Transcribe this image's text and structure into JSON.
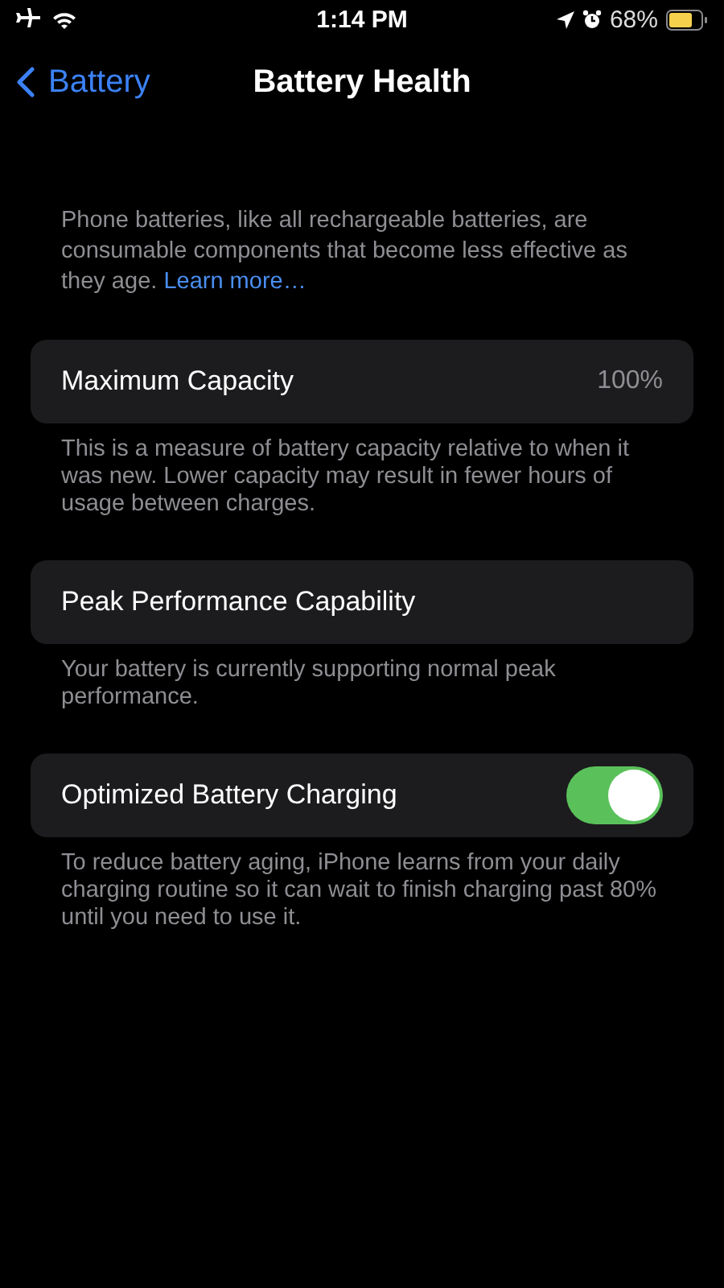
{
  "status_bar": {
    "time": "1:14 PM",
    "battery": "68%"
  },
  "nav": {
    "back": "Battery",
    "title": "Battery Health"
  },
  "intro": {
    "text": "Phone batteries, like all rechargeable batteries, are consumable components that become less effective as they age.",
    "link": "Learn more…"
  },
  "sections": [
    {
      "kind": "value",
      "label": "Maximum Capacity",
      "value": "100%",
      "footer": "This is a measure of battery capacity relative to when it was new. Lower capacity may result in fewer hours of usage between charges."
    },
    {
      "kind": "plain",
      "label": "Peak Performance Capability",
      "footer": "Your battery is currently supporting normal peak performance."
    },
    {
      "kind": "toggle",
      "label": "Optimized Battery Charging",
      "on": true,
      "footer": "To reduce battery aging, iPhone learns from your daily charging routine so it can wait to finish charging past 80% until you need to use it."
    }
  ]
}
